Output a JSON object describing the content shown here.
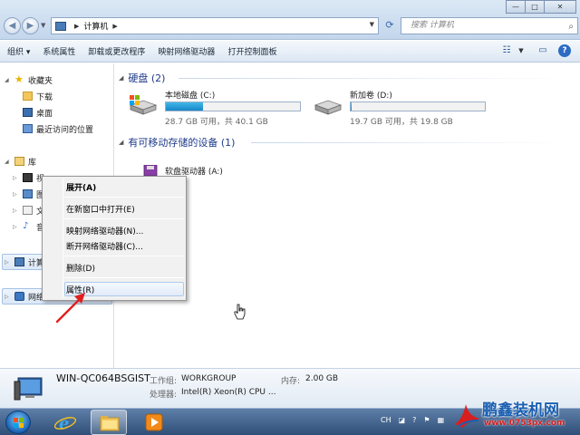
{
  "address": {
    "path": "计算机",
    "search_placeholder": "搜索 计算机"
  },
  "toolbar": {
    "organize": "组织 ▾",
    "system_properties": "系统属性",
    "uninstall": "卸载或更改程序",
    "map_drive": "映射网络驱动器",
    "control_panel": "打开控制面板"
  },
  "nav": {
    "favorites": "收藏夹",
    "downloads": "下载",
    "desktop": "桌面",
    "recent": "最近访问的位置",
    "libraries": "库",
    "lib_video": "视",
    "lib_pictures": "图",
    "lib_documents": "文",
    "lib_music": "音",
    "computer": "计算",
    "network": "网络"
  },
  "content": {
    "hdd_group": "硬盘 (2)",
    "removable_group": "有可移动存储的设备 (1)",
    "drives": [
      {
        "name": "本地磁盘 (C:)",
        "info": "28.7 GB 可用，共 40.1 GB",
        "fill": 0.28
      },
      {
        "name": "新加卷 (D:)",
        "info": "19.7 GB 可用，共 19.8 GB",
        "fill": 0.005
      }
    ],
    "floppy": "软盘驱动器 (A:)"
  },
  "context_menu": {
    "expand": "展开(A)",
    "open_new_window": "在新窗口中打开(E)",
    "map_drive": "映射网络驱动器(N)...",
    "disconnect_drive": "断开网络驱动器(C)...",
    "delete": "删除(D)",
    "properties": "属性(R)"
  },
  "details": {
    "computer_name": "WIN-QC064BSGIST",
    "workgroup_label": "工作组:",
    "workgroup": "WORKGROUP",
    "memory_label": "内存:",
    "memory": "2.00 GB",
    "cpu_label": "处理器:",
    "cpu": "Intel(R) Xeon(R) CPU ..."
  },
  "taskbar": {
    "lang": "CH"
  },
  "watermark": {
    "brand": "鹏鑫装机网",
    "url": "www.0753px.com"
  },
  "colors": {
    "accent": "#1e3a8a",
    "bar_fill": "#26a0da",
    "arrow": "#e02020"
  }
}
